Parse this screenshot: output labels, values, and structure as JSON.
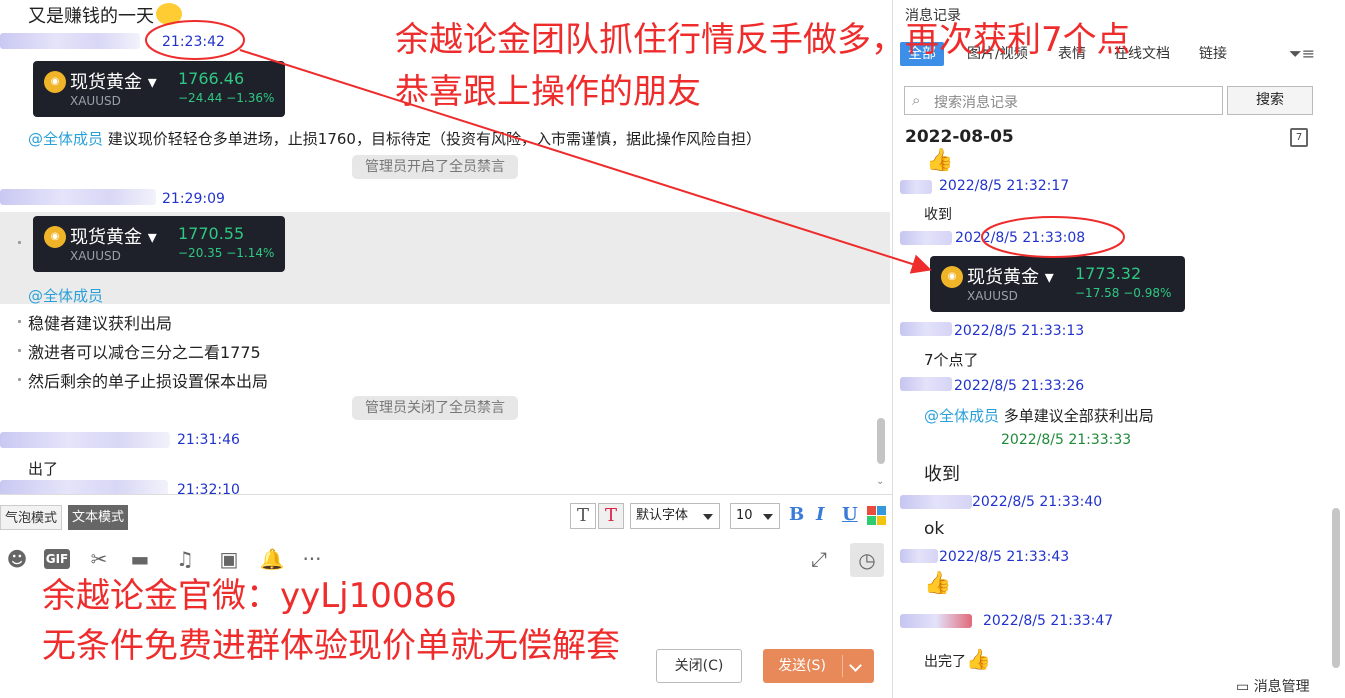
{
  "chat": {
    "header_line": "又是赚钱的一天",
    "msg1_time": "21:23:42",
    "gold_card_1": {
      "name": "现货黄金",
      "symbol": "XAUUSD",
      "price": "1766.46",
      "change": "−24.44   −1.36%"
    },
    "mention": "@全体成员",
    "advice": "建议现价轻轻仓多单进场，止损1760，目标待定（投资有风险，入市需谨慎，据此操作风险自担）",
    "mute_on": "管理员开启了全员禁言",
    "msg2_time": "21:29:09",
    "gold_card_2": {
      "name": "现货黄金",
      "symbol": "XAUUSD",
      "price": "1770.55",
      "change": "−20.35   −1.14%"
    },
    "mention2": "@全体成员",
    "bullets": [
      "稳健者建议获利出局",
      "激进者可以减仓三分之二看1775",
      "然后剩余的单子止损设置保本出局"
    ],
    "mute_off": "管理员关闭了全员禁言",
    "msg3_time": "21:31:46",
    "msg3_text": "出了",
    "msg4_time": "21:32:10"
  },
  "toolbar": {
    "bubble_mode": "气泡模式",
    "text_mode": "文本模式",
    "font_select": "默认字体",
    "size_select": "10",
    "bold": "B",
    "italic": "I",
    "underline": "U"
  },
  "input": {
    "close_label": "关闭(C)",
    "send_label": "发送(S)"
  },
  "overlay": {
    "headline1": "余越论金团队抓住行情反手做多，再次获利7个点",
    "headline2": "恭喜跟上操作的朋友",
    "promo1": "余越论金官微：yyLj10086",
    "promo2": "无条件免费进群体验现价单就无偿解套"
  },
  "history": {
    "title": "消息记录",
    "tabs": [
      "全部",
      "图片/视频",
      "表情",
      "在线文档",
      "链接"
    ],
    "search_placeholder": "搜索消息记录",
    "search_button": "搜索",
    "date": "2022-08-05",
    "calendar_day": "7",
    "entries": [
      {
        "time": "2022/8/5 21:32:17",
        "text": "收到"
      },
      {
        "time": "2022/8/5 21:33:08"
      },
      {
        "time": "2022/8/5 21:33:13",
        "text": "7个点了"
      },
      {
        "time": "2022/8/5 21:33:26",
        "mention": "@全体成员",
        "text": "多单建议全部获利出局"
      },
      {
        "time": "2022/8/5 21:33:33",
        "text": "收到"
      },
      {
        "time": "2022/8/5 21:33:40",
        "text": "ok"
      },
      {
        "time": "2022/8/5 21:33:43"
      },
      {
        "time": "2022/8/5 21:33:47",
        "text": "出完了"
      }
    ],
    "gold_card": {
      "name": "现货黄金",
      "symbol": "XAUUSD",
      "price": "1773.32",
      "change": "−17.58   −0.98%"
    },
    "manage": "消息管理"
  },
  "colors": {
    "accent_blue": "#3c8ee6",
    "timestamp_blue": "#2233cc",
    "overlay_red": "#ee2c2c",
    "send_orange": "#e8895a",
    "gold_green": "#2fc883"
  }
}
